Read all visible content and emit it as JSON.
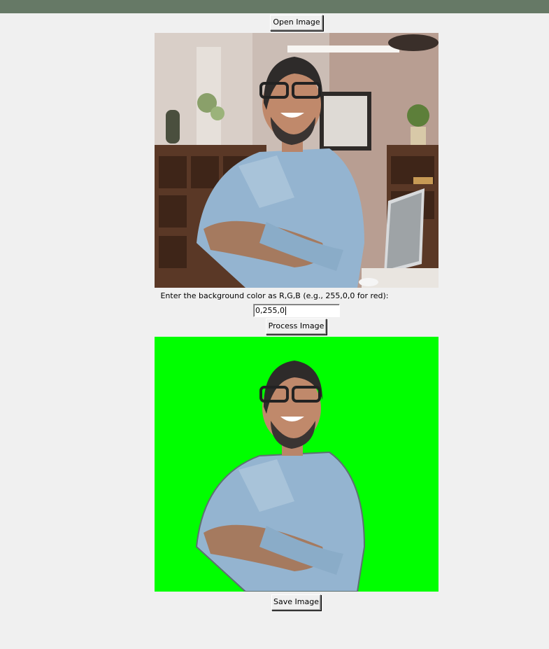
{
  "window": {
    "title_bar_color": "#667966"
  },
  "buttons": {
    "open": "Open Image",
    "process": "Process Image",
    "save": "Save Image"
  },
  "prompt": "Enter the background color as R,G,B (e.g., 255,0,0 for red):",
  "color_entry": {
    "value": "0,255,0"
  },
  "colors": {
    "window_bg": "#f0f0f0",
    "processed_bg": "#00ff00"
  }
}
